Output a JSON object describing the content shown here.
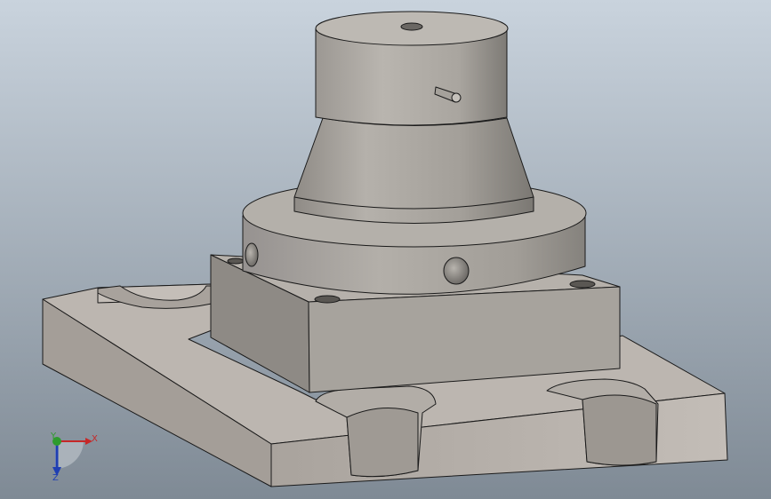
{
  "viewport": {
    "background_top": "#c9d3dd",
    "background_bottom": "#7f8a95"
  },
  "triad": {
    "x_label": "X",
    "y_label": "Y",
    "z_label": "Z",
    "x_color": "#c62828",
    "y_color": "#2e9b2e",
    "z_color": "#1f3fb3"
  },
  "colors": {
    "metal_light": "#bdb8b2",
    "metal_mid": "#a7a29c",
    "metal_dark": "#8a8580",
    "cylinder_light": "#b4b0aa",
    "cylinder_dark": "#7d7a75",
    "edge": "#1a1a1a"
  }
}
